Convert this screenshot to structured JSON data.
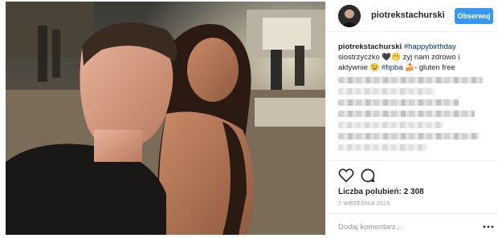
{
  "post": {
    "username": "piotrekstachurski",
    "follow_label": "Obserwuj",
    "caption": {
      "username": "piotrekstachurski",
      "hashtag1": "#happybirthday",
      "text1": "siostrzyczko 🖤🫢 żyj nam zdrowo i aktywnie 😉",
      "hashtag2": "#hpba",
      "text2": "🍰- gluten free"
    },
    "likes_text": "Liczba polubień: 2 308",
    "date_text": "7 WRZEŚNIA 2015",
    "comment_placeholder": "Dodaj komentarz..."
  },
  "colors": {
    "accent": "#3897f0",
    "hashtag": "#003569",
    "text": "#262626",
    "muted": "#999999"
  },
  "icons": {
    "like": "heart-icon",
    "comment": "comment-icon",
    "more": "more-options-icon"
  }
}
